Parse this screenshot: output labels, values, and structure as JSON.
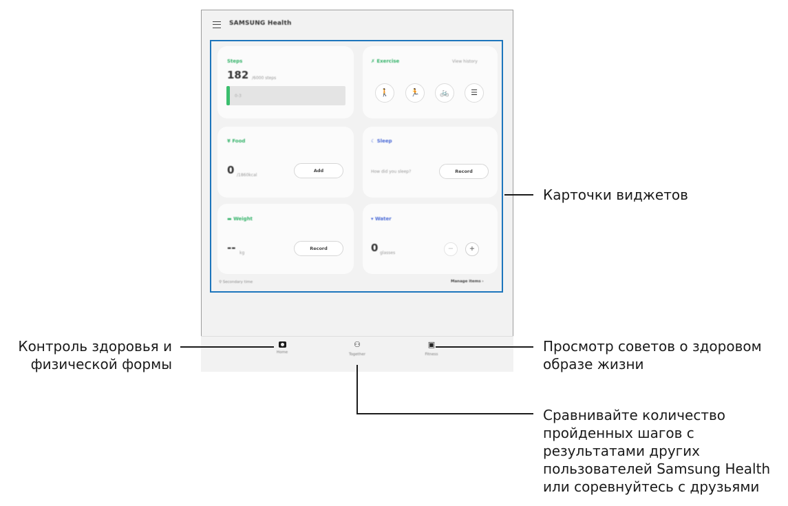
{
  "app": {
    "title": "SAMSUNG Health"
  },
  "cards": {
    "steps": {
      "title": "Steps",
      "value": "182",
      "unit": "/6000 steps",
      "target_label": "0-3",
      "progress": 0.03
    },
    "exercise": {
      "title": "Exercise",
      "link": "View history",
      "activities": [
        "walk-icon",
        "run-icon",
        "bike-icon",
        "list-icon"
      ]
    },
    "food": {
      "title": "Food",
      "value": "0",
      "unit": "/1860kcal",
      "button": "Add"
    },
    "sleep": {
      "title": "Sleep",
      "prompt": "How did you sleep?",
      "button": "Record"
    },
    "weight": {
      "title": "Weight",
      "value": "--",
      "unit": "kg",
      "button": "Record"
    },
    "water": {
      "title": "Water",
      "value": "0",
      "unit": "glasses",
      "minus": "−",
      "plus": "+"
    }
  },
  "footer": {
    "left": "Secondary time",
    "right": "Manage items"
  },
  "nav": {
    "home": "Home",
    "together": "Together",
    "fitness": "Fitness"
  },
  "callouts": {
    "widgets": "Карточки виджетов",
    "home": "Контроль здоровья и\nфизической формы",
    "fitness": "Просмотр советов о здоровом\nобразе жизни",
    "together": "Сравнивайте количество\nпройденных шагов с\nрезультатами других\nпользователей Samsung Health\nили соревнуйтесь с друзьями"
  },
  "colors": {
    "accent_green": "#35b36a",
    "highlight_blue": "#1c75bc",
    "sleep_blue": "#4a6ad6"
  }
}
